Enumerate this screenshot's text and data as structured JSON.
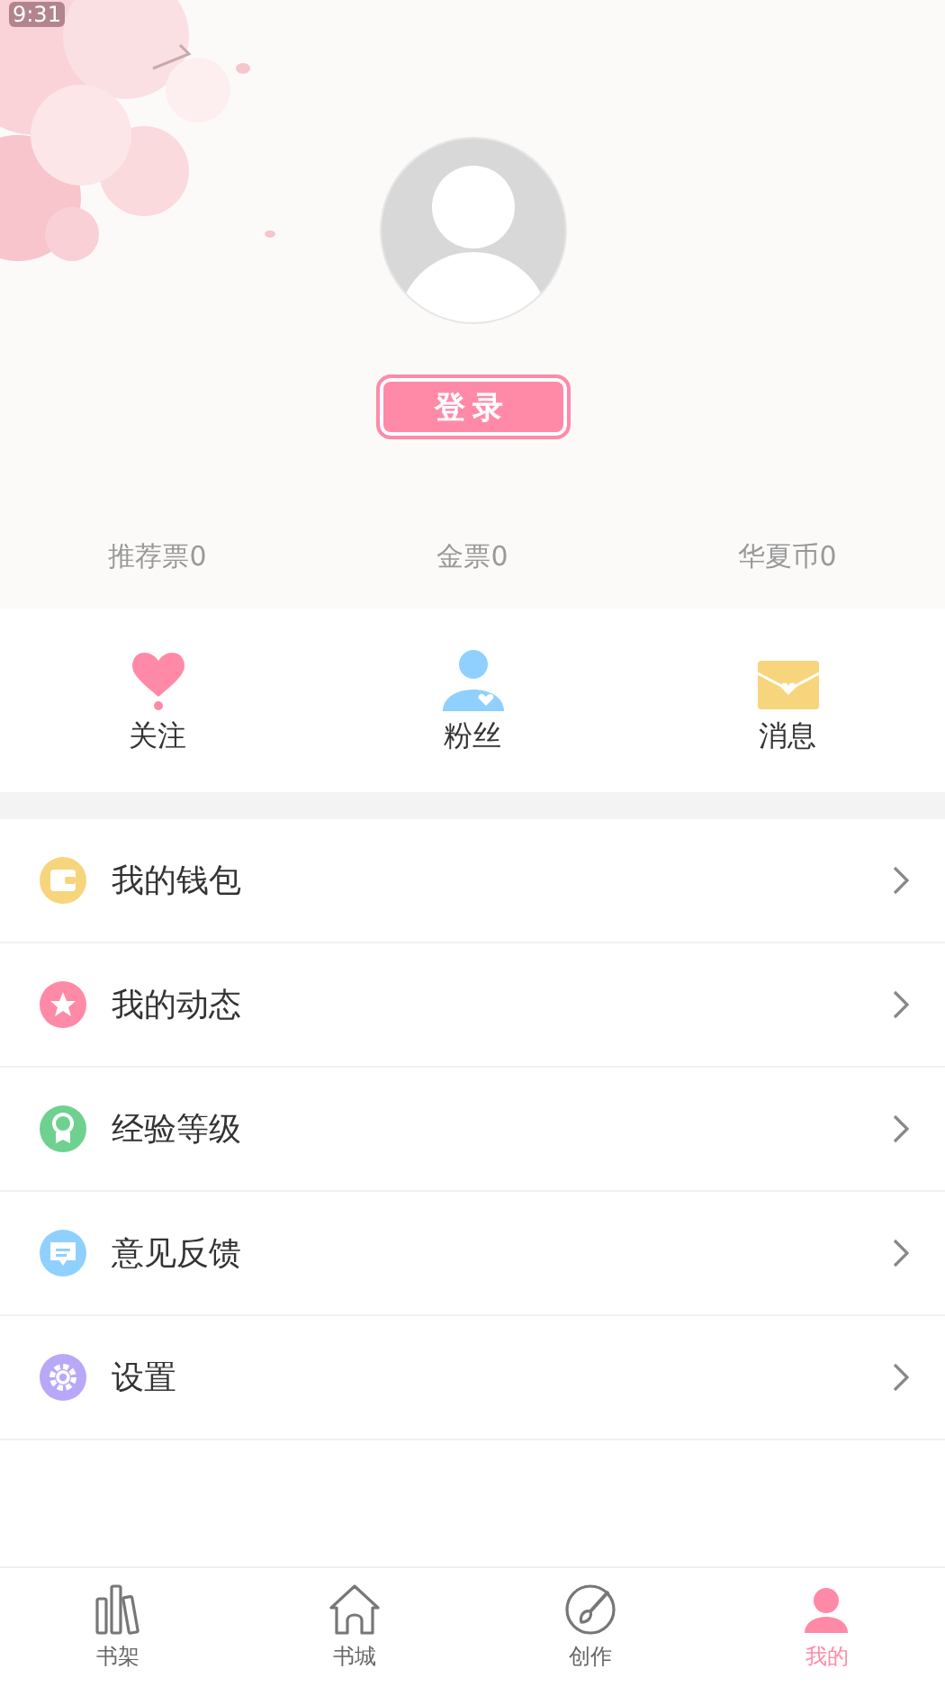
{
  "status_bar": {
    "time": "9:31"
  },
  "profile": {
    "login_button": "登录",
    "stats": [
      "推荐票0",
      "金票0",
      "华夏币0"
    ]
  },
  "quick_links": [
    {
      "kind": "heart",
      "label": "关注"
    },
    {
      "kind": "person",
      "label": "粉丝"
    },
    {
      "kind": "envelope",
      "label": "消息"
    }
  ],
  "menu": [
    {
      "kind": "wallet",
      "label": "我的钱包"
    },
    {
      "kind": "star",
      "label": "我的动态"
    },
    {
      "kind": "medal",
      "label": "经验等级"
    },
    {
      "kind": "chat",
      "label": "意见反馈"
    },
    {
      "kind": "gear",
      "label": "设置"
    }
  ],
  "tab_bar": [
    {
      "kind": "books",
      "label": "书架",
      "selected": false
    },
    {
      "kind": "home",
      "label": "书城",
      "selected": false
    },
    {
      "kind": "brush",
      "label": "创作",
      "selected": false
    },
    {
      "kind": "profile",
      "label": "我的",
      "selected": true
    }
  ]
}
